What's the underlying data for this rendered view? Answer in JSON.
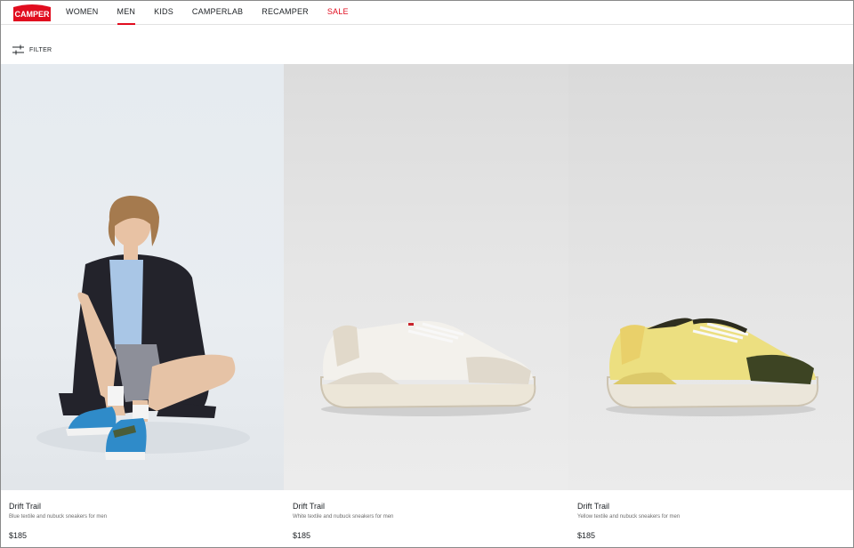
{
  "header": {
    "logo_text": "CAMPER",
    "nav": [
      {
        "label": "WOMEN",
        "active": false
      },
      {
        "label": "MEN",
        "active": true
      },
      {
        "label": "KIDS",
        "active": false
      },
      {
        "label": "CAMPERLAB",
        "active": false
      },
      {
        "label": "RECAMPER",
        "active": false
      },
      {
        "label": "SALE",
        "active": false
      }
    ]
  },
  "toolbar": {
    "filter_label": "FILTER"
  },
  "products": [
    {
      "name": "Drift Trail",
      "description": "Blue textile and nubuck sneakers for men",
      "price": "$185"
    },
    {
      "name": "Drift Trail",
      "description": "White textile and nubuck sneakers for men",
      "price": "$185"
    },
    {
      "name": "Drift Trail",
      "description": "Yellow textile and nubuck sneakers for men",
      "price": "$185"
    }
  ],
  "colors": {
    "brand_red": "#e10d1f",
    "sale_red": "#e10d1f"
  }
}
